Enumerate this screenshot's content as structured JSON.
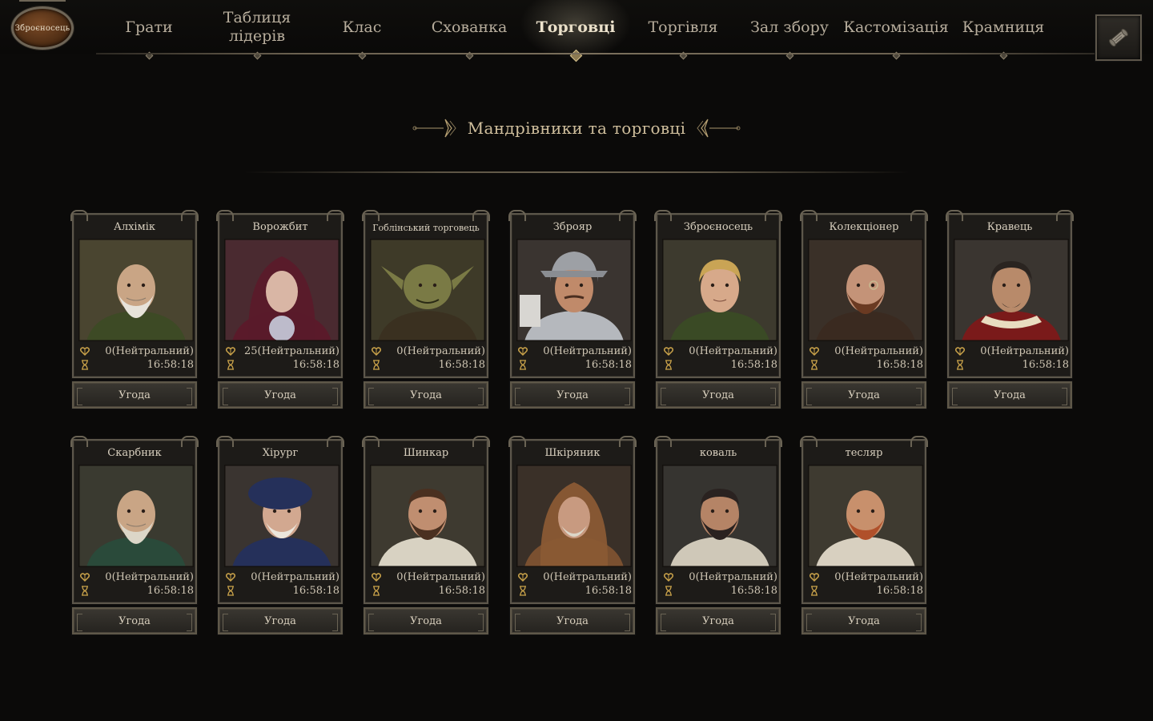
{
  "header": {
    "badge_label": "Зброєносець",
    "nav": [
      {
        "label": "Грати"
      },
      {
        "label": "Таблиця лідерів"
      },
      {
        "label": "Клас"
      },
      {
        "label": "Схованка"
      },
      {
        "label": "Торговці",
        "active": true
      },
      {
        "label": "Торгівля"
      },
      {
        "label": "Зал збору"
      },
      {
        "label": "Кастомізація"
      },
      {
        "label": "Крамниця"
      }
    ],
    "scroll_icon": "scroll-icon"
  },
  "section": {
    "title": "Мандрівники та торговці"
  },
  "colors": {
    "accent": "#cfbe9c",
    "relation_icon": "#c9a24a",
    "background": "#0b0a09"
  },
  "merchants": [
    {
      "name": "Алхімік",
      "relation": "0(Нейтральний)",
      "timer": "16:58:18",
      "deal": "Угода",
      "palette": {
        "bg": "#4a4530",
        "face": "#c9a585",
        "hair": "#e7e3da",
        "cloth": "#3d4a25"
      },
      "type": "elder"
    },
    {
      "name": "Ворожбит",
      "relation": "25(Нейтральний)",
      "timer": "16:58:18",
      "deal": "Угода",
      "palette": {
        "bg": "#4a2a30",
        "face": "#d9b6a5",
        "hair": "#6a1c2a",
        "cloth": "#5a1a2a"
      },
      "type": "hood"
    },
    {
      "name": "Гоблінський торговець",
      "relation": "0(Нейтральний)",
      "timer": "16:58:18",
      "deal": "Угода",
      "palette": {
        "bg": "#3e3a28",
        "face": "#7a7a45",
        "hair": "#5a5a30",
        "cloth": "#3a3020"
      },
      "type": "goblin"
    },
    {
      "name": "Зброяр",
      "relation": "0(Нейтральний)",
      "timer": "16:58:18",
      "deal": "Угода",
      "palette": {
        "bg": "#3a3430",
        "face": "#c08a6a",
        "hair": "#9da0a5",
        "cloth": "#b5b8bd"
      },
      "type": "helmet"
    },
    {
      "name": "Зброєносець",
      "relation": "0(Нейтральний)",
      "timer": "16:58:18",
      "deal": "Угода",
      "palette": {
        "bg": "#3d3a2e",
        "face": "#d7a98a",
        "hair": "#c9a455",
        "cloth": "#3a4a25"
      },
      "type": "youth"
    },
    {
      "name": "Колекціонер",
      "relation": "0(Нейтральний)",
      "timer": "16:58:18",
      "deal": "Угода",
      "palette": {
        "bg": "#3a3028",
        "face": "#c49378",
        "hair": "#6a3a22",
        "cloth": "#3a2a20"
      },
      "type": "bald-beard"
    },
    {
      "name": "Кравець",
      "relation": "0(Нейтральний)",
      "timer": "16:58:18",
      "deal": "Угода",
      "palette": {
        "bg": "#3a3530",
        "face": "#b88a6a",
        "hair": "#2a2420",
        "cloth": "#7a1a1a"
      },
      "type": "noble"
    },
    {
      "name": "Скарбник",
      "relation": "0(Нейтральний)",
      "timer": "16:58:18",
      "deal": "Угода",
      "palette": {
        "bg": "#3a3a30",
        "face": "#c9a585",
        "hair": "#dcd6c8",
        "cloth": "#2a4a3a"
      },
      "type": "elder"
    },
    {
      "name": "Хірург",
      "relation": "0(Нейтральний)",
      "timer": "16:58:18",
      "deal": "Угода",
      "palette": {
        "bg": "#3a3430",
        "face": "#d2a890",
        "hair": "#ece6dc",
        "cloth": "#25305a"
      },
      "type": "beret"
    },
    {
      "name": "Шинкар",
      "relation": "0(Нейтральний)",
      "timer": "16:58:18",
      "deal": "Угода",
      "palette": {
        "bg": "#3e3a30",
        "face": "#c08e70",
        "hair": "#4a3020",
        "cloth": "#d8d2c2"
      },
      "type": "beard"
    },
    {
      "name": "Шкіряник",
      "relation": "0(Нейтральний)",
      "timer": "16:58:18",
      "deal": "Угода",
      "palette": {
        "bg": "#3a3028",
        "face": "#c89a80",
        "hair": "#dcd6c8",
        "cloth": "#7a5030"
      },
      "type": "hood-old"
    },
    {
      "name": "коваль",
      "relation": "0(Нейтральний)",
      "timer": "16:58:18",
      "deal": "Угода",
      "palette": {
        "bg": "#363430",
        "face": "#b58466",
        "hair": "#2a2220",
        "cloth": "#cfc8b8"
      },
      "type": "beard"
    },
    {
      "name": "тесляр",
      "relation": "0(Нейтральний)",
      "timer": "16:58:18",
      "deal": "Угода",
      "palette": {
        "bg": "#3e3a30",
        "face": "#c8906c",
        "hair": "#b0502a",
        "cloth": "#d8d0c0"
      },
      "type": "red-beard"
    }
  ]
}
